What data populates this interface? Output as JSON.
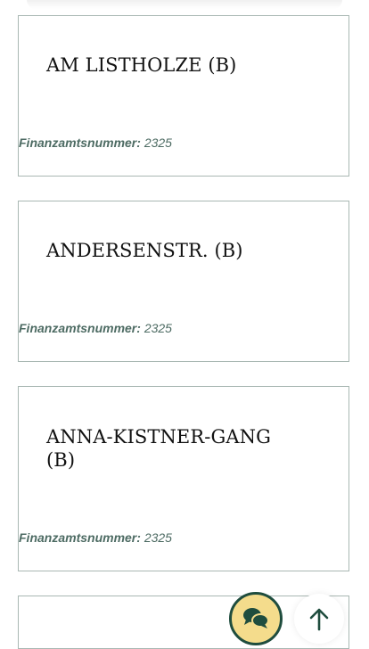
{
  "entries": [
    {
      "title": "AM LISTHOLZE (B)",
      "meta_label": "Finanzamtsnummer:",
      "meta_value": "2325"
    },
    {
      "title": "ANDERSENSTR. (B)",
      "meta_label": "Finanzamtsnummer:",
      "meta_value": "2325"
    },
    {
      "title": "ANNA-KISTNER-GANG (B)",
      "meta_label": "Finanzamtsnummer:",
      "meta_value": "2325"
    }
  ],
  "floating_actions": {
    "chat_icon": "chat-bubbles-icon",
    "scroll_top_icon": "arrow-up-icon"
  },
  "colors": {
    "accent_dark_green": "#1f4d3e",
    "chat_button_fill": "#f4dc8c",
    "card_border": "#a9b8b3",
    "meta_text": "#4d6b63"
  }
}
